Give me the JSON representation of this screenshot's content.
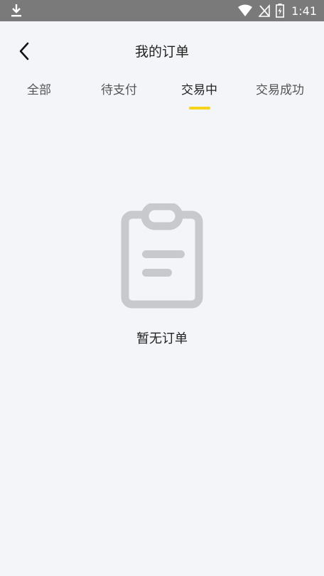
{
  "status_bar": {
    "time": "1:41",
    "icons": [
      "download-icon",
      "wifi-icon",
      "no-signal-icon",
      "battery-charging-icon"
    ]
  },
  "header": {
    "title": "我的订单",
    "back_icon": "back-arrow-icon"
  },
  "tabs": [
    {
      "label": "全部",
      "active": false
    },
    {
      "label": "待支付",
      "active": false
    },
    {
      "label": "交易中",
      "active": true
    },
    {
      "label": "交易成功",
      "active": false
    }
  ],
  "empty_state": {
    "icon": "clipboard-icon",
    "message": "暂无订单"
  },
  "colors": {
    "background": "#f4f5f9",
    "status_bar": "#7a7a7a",
    "accent": "#f5d21c",
    "icon_gray": "#c8c9cc"
  }
}
